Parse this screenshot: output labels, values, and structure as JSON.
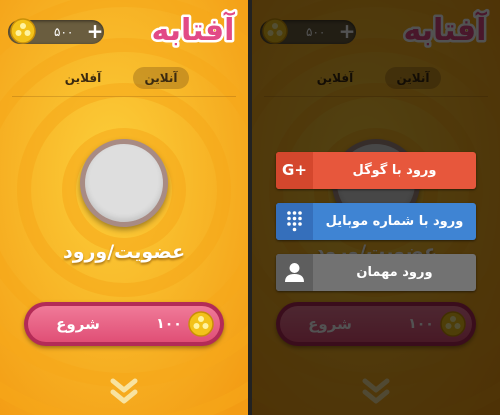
{
  "app": {
    "logo_text": "آفتابه"
  },
  "header": {
    "coins": "۵۰۰",
    "add_label": "+"
  },
  "tabs": [
    {
      "label": "آنلاین",
      "active": true
    },
    {
      "label": "آفلاین",
      "active": false
    }
  ],
  "profile": {
    "login_label": "عضویت/ورود"
  },
  "start": {
    "label": "شروع",
    "cost": "۱۰۰"
  },
  "login_dialog": {
    "google_label": "ورود با گوگل",
    "google_icon_text": "G+",
    "mobile_label": "ورود با شماره موبایل",
    "guest_label": "ورود مهمان"
  },
  "icons": [
    "coin-icon",
    "plus-icon",
    "google-plus-icon",
    "dialpad-icon",
    "user-icon",
    "double-chevron-down-icon"
  ],
  "colors": {
    "background_orange": "#f7b620",
    "start_button": "#e9597f",
    "google_button": "#e7573c",
    "mobile_button": "#3f84d3",
    "guest_button": "#727272",
    "logo_fill": "#e24a86"
  }
}
